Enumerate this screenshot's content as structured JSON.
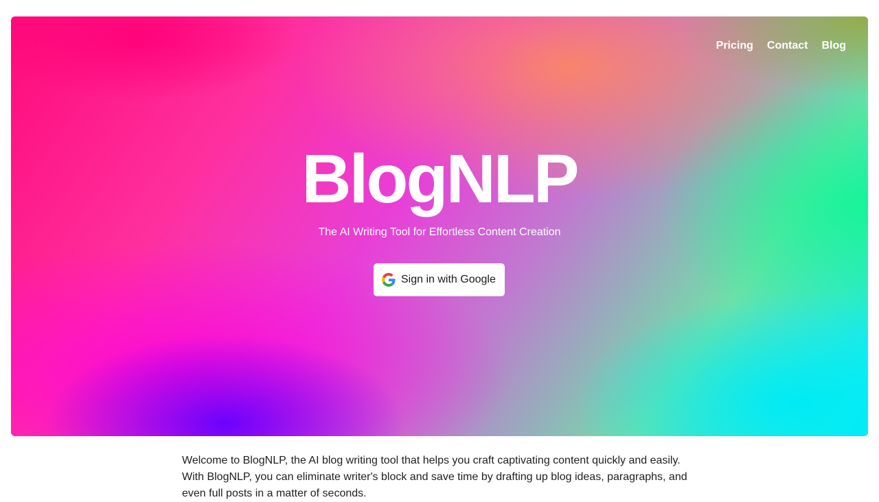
{
  "nav": {
    "items": [
      {
        "label": "Pricing"
      },
      {
        "label": "Contact"
      },
      {
        "label": "Blog"
      }
    ]
  },
  "hero": {
    "title": "BlogNLP",
    "subtitle": "The AI Writing Tool for Effortless Content Creation",
    "signin": {
      "icon": "google-g-icon",
      "label": "Sign in with Google"
    }
  },
  "intro": {
    "text": "Welcome to BlogNLP, the AI blog writing tool that helps you craft captivating content quickly and easily. With BlogNLP, you can eliminate writer's block and save time by drafting up blog ideas, paragraphs, and even full posts in a matter of seconds."
  },
  "colors": {
    "hero_magenta": "#ff0a7a",
    "hero_purple": "#6400ff",
    "hero_green": "#14f596",
    "hero_cyan": "#00ebf5",
    "text_white": "#ffffff",
    "body_text": "#1f1f1f"
  }
}
